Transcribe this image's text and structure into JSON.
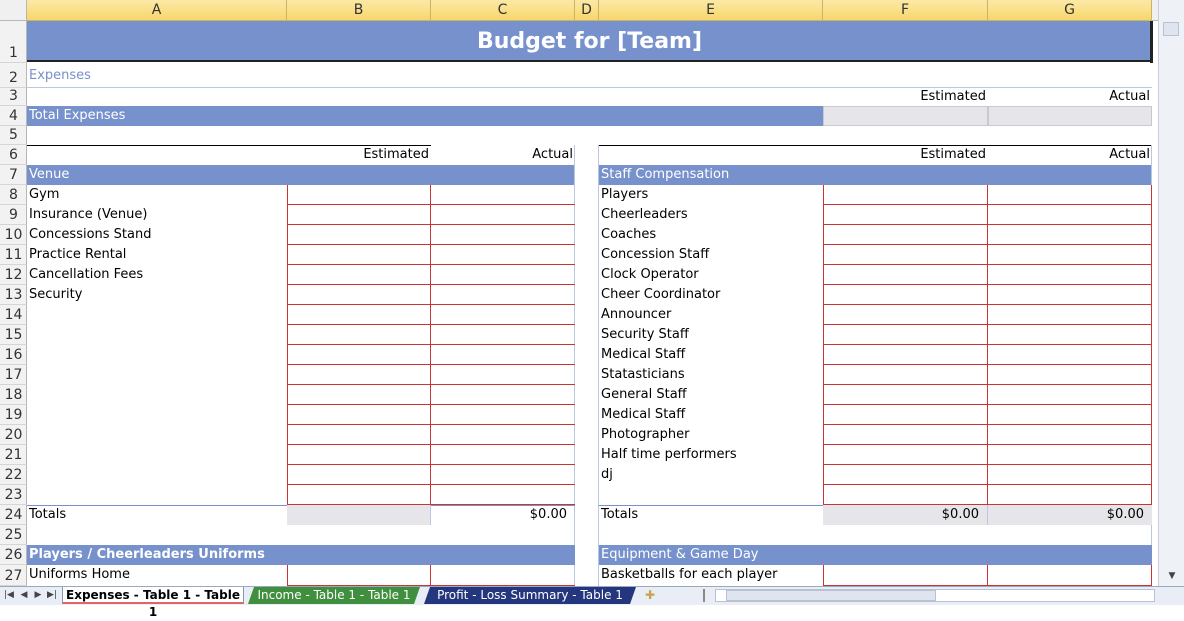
{
  "columns": [
    "A",
    "B",
    "C",
    "D",
    "E",
    "F",
    "G"
  ],
  "rows": [
    "1",
    "2",
    "3",
    "4",
    "5",
    "6",
    "7",
    "8",
    "9",
    "10",
    "11",
    "12",
    "13",
    "14",
    "15",
    "16",
    "17",
    "18",
    "19",
    "20",
    "21",
    "22",
    "23",
    "24",
    "25",
    "26",
    "27"
  ],
  "title": "Budget for [Team]",
  "expenses_label": "Expenses",
  "estimated": "Estimated",
  "actual": "Actual",
  "total_expenses": "Total Expenses",
  "venue": {
    "header": "Venue",
    "items": [
      "Gym",
      "Insurance (Venue)",
      "Concessions Stand",
      "Practice Rental",
      "Cancellation Fees",
      "Security"
    ],
    "totals_label": "Totals",
    "total_actual": "$0.00"
  },
  "staff": {
    "header": "Staff Compensation",
    "items": [
      "Players",
      "Cheerleaders",
      "Coaches",
      "Concession Staff",
      "Clock Operator",
      "Cheer Coordinator",
      "Announcer",
      "Security Staff",
      "Medical Staff",
      "Statasticians",
      "General Staff",
      "Medical Staff",
      "Photographer",
      "Half time performers",
      "dj"
    ],
    "totals_label": "Totals",
    "total_estimated": "$0.00",
    "total_actual": "$0.00"
  },
  "uniforms": {
    "header": "Players / Cheerleaders Uniforms",
    "item1": "Uniforms Home"
  },
  "equipment": {
    "header": "Equipment & Game Day",
    "item1": "Basketballs for each player"
  },
  "sheet_tabs": [
    "Expenses - Table 1 - Table 1",
    "Income - Table 1 - Table 1",
    "Profit - Loss Summary - Table 1"
  ],
  "colors": {
    "header_fill": "#7691cb",
    "column_header": "#f7d66a",
    "grid_red": "#cc3333",
    "total_fill": "#e5e5ea"
  }
}
